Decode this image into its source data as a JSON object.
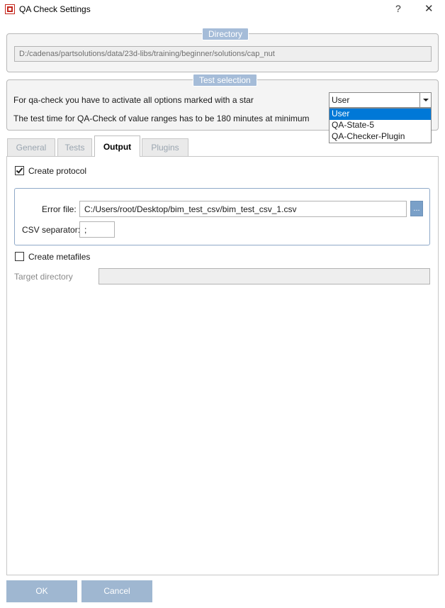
{
  "window": {
    "title": "QA Check Settings",
    "help_label": "?",
    "close_label": "✕"
  },
  "directory_group": {
    "legend": "Directory",
    "path": "D:/cadenas/partsolutions/data/23d-libs/training/beginner/solutions/cap_nut"
  },
  "test_selection": {
    "legend": "Test selection",
    "info_1": "For qa-check you have to activate all options marked with a star",
    "info_2": "The test time for QA-Check of value ranges has to be 180 minutes at minimum",
    "combo_value": "User",
    "options": [
      "User",
      "QA-State-5",
      "QA-Checker-Plugin"
    ],
    "selected_index": 0
  },
  "tabs": [
    {
      "label": "General",
      "active": false
    },
    {
      "label": "Tests",
      "active": false
    },
    {
      "label": "Output",
      "active": true
    },
    {
      "label": "Plugins",
      "active": false
    }
  ],
  "output": {
    "create_protocol_label": "Create protocol",
    "create_protocol_checked": true,
    "error_file_label": "Error file:",
    "error_file_value": "C:/Users/root/Desktop/bim_test_csv/bim_test_csv_1.csv",
    "browse_label": "...",
    "csv_separator_label": "CSV separator:",
    "csv_separator_value": ";",
    "create_metafiles_label": "Create metafiles",
    "create_metafiles_checked": false,
    "target_directory_label": "Target directory",
    "target_directory_value": ""
  },
  "buttons": {
    "ok": "OK",
    "cancel": "Cancel"
  },
  "colors": {
    "accent": "#0078d7",
    "legend_bg": "#a5bcd8",
    "button_bg": "#9fb7d1",
    "app_icon": "#c4261d"
  }
}
